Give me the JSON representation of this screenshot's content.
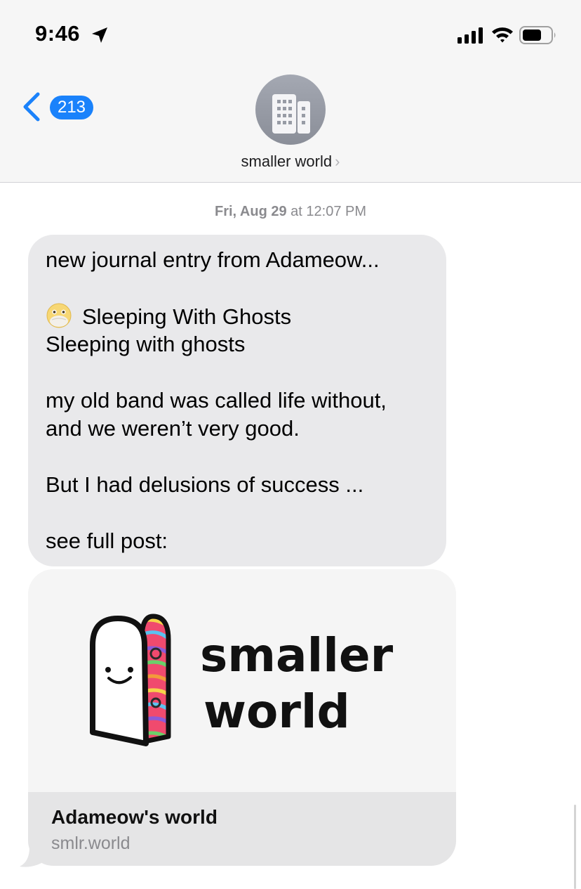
{
  "status_bar": {
    "time": "9:46"
  },
  "nav": {
    "back_count": "213",
    "contact_name": "smaller world"
  },
  "thread": {
    "timestamp_day": "Fri, Aug 29",
    "timestamp_time": "at 12:07 PM",
    "message": {
      "line1": "new journal entry from Adameow...",
      "line2": "Sleeping With Ghosts",
      "line3": "Sleeping with ghosts",
      "line4": "my old band was called life without,",
      "line5": "and we weren’t very good.",
      "line6": "But I had delusions of success ...",
      "line7": "see full post:"
    },
    "link_preview": {
      "logo_line1": "smaller",
      "logo_line2": "world",
      "title": "Adameow's world",
      "domain": "smlr.world"
    }
  },
  "colors": {
    "accent": "#1a82fb",
    "incoming_bubble": "#e9e9eb"
  },
  "icons": [
    "location-arrow-icon",
    "signal-icon",
    "wifi-icon",
    "battery-icon",
    "back-chevron-icon",
    "building-icon",
    "face-with-open-eyes-and-hand-over-mouth-emoji"
  ]
}
